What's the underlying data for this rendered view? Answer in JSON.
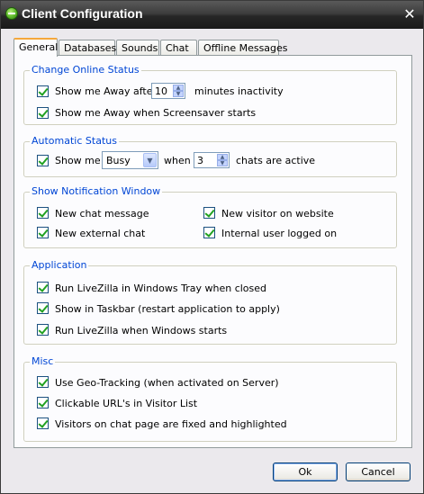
{
  "window": {
    "title": "Client Configuration",
    "close_glyph": "✕"
  },
  "tabs": [
    {
      "label": "General",
      "active": true
    },
    {
      "label": "Databases",
      "active": false
    },
    {
      "label": "Sounds",
      "active": false
    },
    {
      "label": "Chat",
      "active": false
    },
    {
      "label": "Offline Messages",
      "active": false
    }
  ],
  "change_online_status": {
    "title": "Change Online Status",
    "away_after_label": "Show me Away after",
    "away_after_checked": true,
    "away_minutes": "10",
    "minutes_suffix": "minutes inactivity",
    "screensaver_label": "Show me Away when Screensaver starts",
    "screensaver_checked": true
  },
  "automatic_status": {
    "title": "Automatic Status",
    "show_me_label": "Show me",
    "show_me_checked": true,
    "status_value": "Busy",
    "when_label": "when",
    "chat_count": "3",
    "suffix": "chats are active"
  },
  "notification_window": {
    "title": "Show Notification Window",
    "items": [
      {
        "label": "New chat message",
        "checked": true
      },
      {
        "label": "New visitor on website",
        "checked": true
      },
      {
        "label": "New external chat",
        "checked": true
      },
      {
        "label": "Internal user logged on",
        "checked": true
      }
    ]
  },
  "application": {
    "title": "Application",
    "items": [
      {
        "label": "Run LiveZilla in Windows Tray when closed",
        "checked": true
      },
      {
        "label": "Show in Taskbar (restart application to apply)",
        "checked": true
      },
      {
        "label": "Run LiveZilla when Windows starts",
        "checked": true
      }
    ]
  },
  "misc": {
    "title": "Misc",
    "items": [
      {
        "label": "Use Geo-Tracking (when activated on Server)",
        "checked": true
      },
      {
        "label": "Clickable URL's in Visitor List",
        "checked": true
      },
      {
        "label": "Visitors on chat page are fixed and highlighted",
        "checked": true
      }
    ]
  },
  "buttons": {
    "ok_label": "Ok",
    "cancel_label": "Cancel"
  },
  "colors": {
    "group_title": "#0046d5",
    "check_mark": "#21a121",
    "title_bar": "#262626"
  }
}
